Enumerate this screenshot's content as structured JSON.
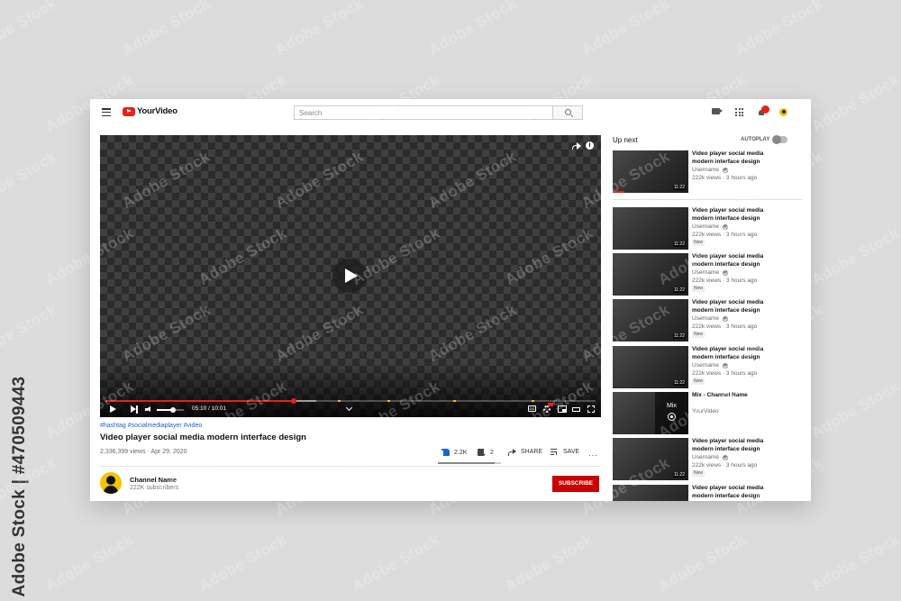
{
  "stock_id": "Adobe Stock | #470509443",
  "watermark_text": "Adobe Stock",
  "colors": {
    "brand": "#e62117",
    "subscribe": "#cc0000",
    "link": "#1a5fd8",
    "like_active": "#1565d8"
  },
  "header": {
    "logo_text": "YourVideo",
    "search": {
      "placeholder": "Search"
    },
    "notification_count": "",
    "icons": [
      "menu-icon",
      "logo-icon",
      "search-icon",
      "video-camera-icon",
      "apps-grid-icon",
      "bell-icon",
      "avatar"
    ]
  },
  "player": {
    "current_time": "05:10",
    "duration": "10:01",
    "time_display": "05:10 / 10:01",
    "progress_fraction": 0.385,
    "buffered_fraction": 0.43,
    "volume_fraction": 0.6,
    "chapter_markers_fraction": [
      0.475,
      0.575,
      0.71,
      0.87
    ],
    "icons": [
      "share-icon",
      "info-icon",
      "play-icon",
      "next-icon",
      "volume-icon",
      "chevron-down-icon",
      "captions-icon",
      "settings-gear-icon",
      "miniplayer-icon",
      "theater-icon",
      "fullscreen-icon"
    ]
  },
  "video": {
    "hashtags": "#hashtag #socialmediaplayer #video",
    "title": "Video player social media modern interface design",
    "meta": "2,336,399 views · Apr 29, 2020",
    "likes": "2.2K",
    "dislikes": "2",
    "share_label": "SHARE",
    "save_label": "SAVE",
    "like_ratio": 0.9
  },
  "channel": {
    "name": "Channel Name",
    "subscribers": "222K subscribers",
    "subscribe_label": "SUBSCRIBE"
  },
  "sidebar": {
    "upnext_label": "Up next",
    "autoplay_label": "AUTOPLAY",
    "autoplay_on": false,
    "items": [
      {
        "title": "Video player social media modern interface design",
        "user": "Username",
        "views": "222k views · 3 hours ago",
        "duration": "11:22",
        "badge": "",
        "progress": 0.15,
        "mix": false
      },
      {
        "title": "Video player social media modern interface design",
        "user": "Username",
        "views": "222k views · 3 hours ago",
        "duration": "11:22",
        "badge": "New",
        "progress": 0,
        "mix": false
      },
      {
        "title": "Video player social media modern interface design",
        "user": "Username",
        "views": "222k views · 3 hours ago",
        "duration": "11:22",
        "badge": "New",
        "progress": 0,
        "mix": false
      },
      {
        "title": "Video player social media modern interface design",
        "user": "Username",
        "views": "222k views · 3 hours ago",
        "duration": "11:22",
        "badge": "New",
        "progress": 0,
        "mix": false
      },
      {
        "title": "Video player social media modern interface design",
        "user": "Username",
        "views": "222k views · 3 hours ago",
        "duration": "11:22",
        "badge": "New",
        "progress": 0,
        "mix": false
      },
      {
        "title": "Mix - Channel Name",
        "user": "YourVideo",
        "views": "",
        "duration": "",
        "badge": "",
        "progress": 0,
        "mix": true,
        "mix_label": "Mix"
      },
      {
        "title": "Video player social media modern interface design",
        "user": "Username",
        "views": "222k views · 3 hours ago",
        "duration": "11:22",
        "badge": "New",
        "progress": 0,
        "mix": false
      },
      {
        "title": "Video player social media modern interface design",
        "user": "",
        "views": "",
        "duration": "",
        "badge": "",
        "progress": 0,
        "mix": false
      }
    ]
  }
}
